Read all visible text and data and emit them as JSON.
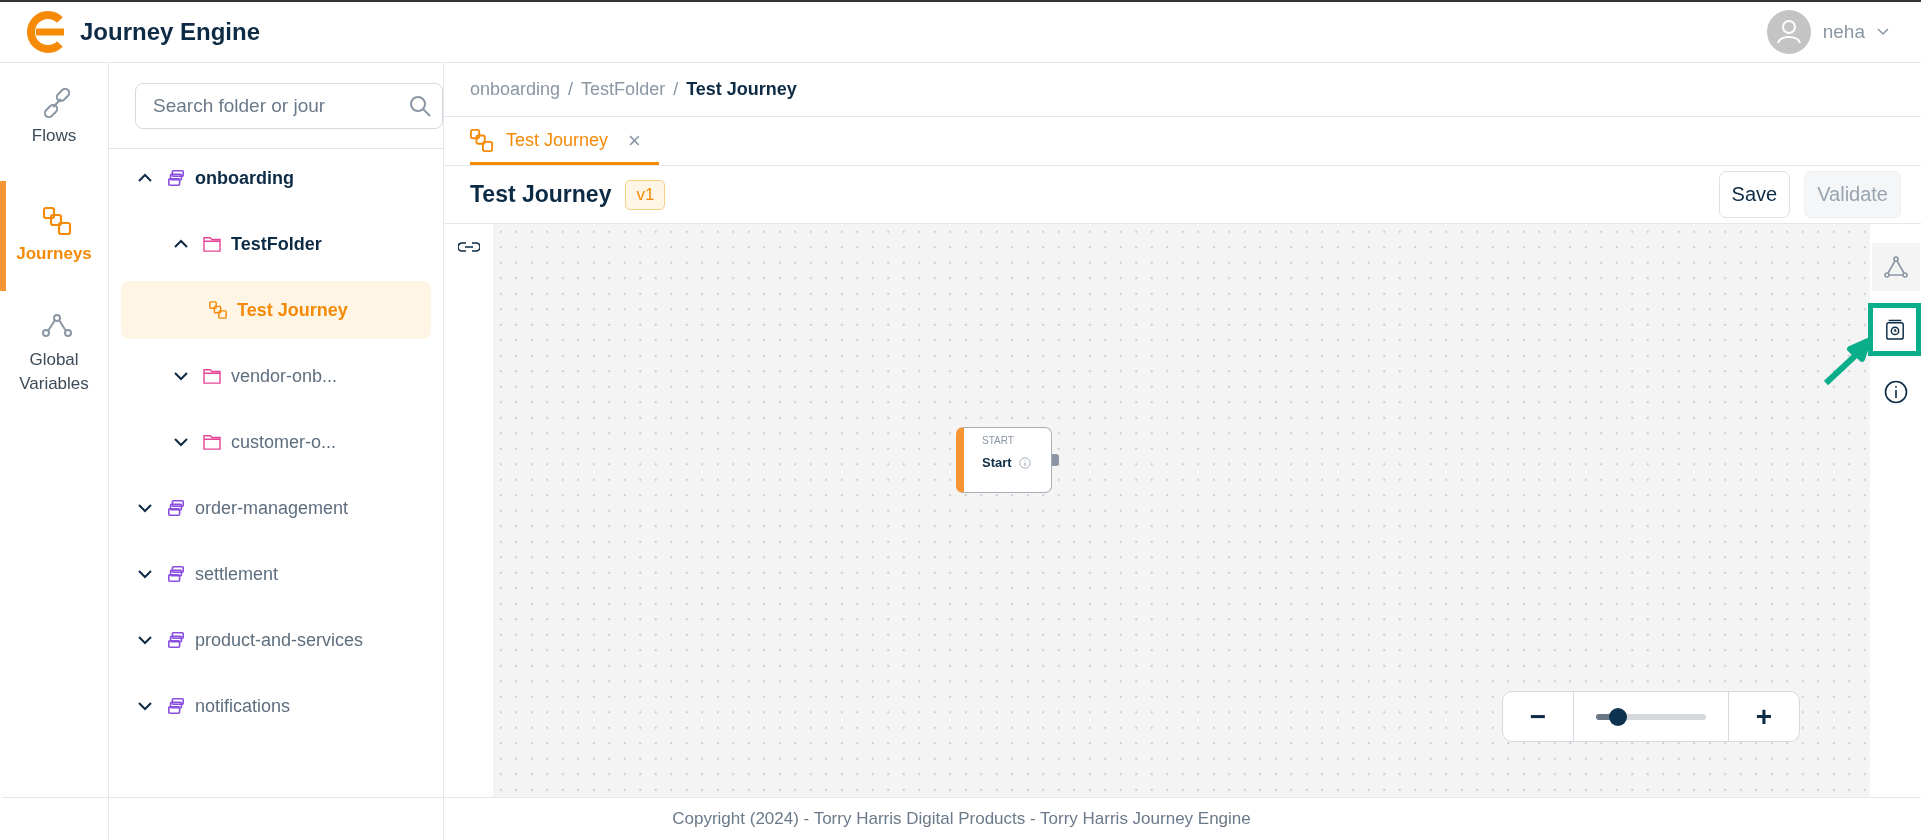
{
  "header": {
    "app_name": "Journey Engine",
    "user": {
      "name": "neha"
    }
  },
  "nav": [
    {
      "label": "Flows",
      "kind": "flows",
      "selected": false
    },
    {
      "label": "Journeys",
      "kind": "journeys",
      "selected": true
    },
    {
      "label": "Global Variables",
      "kind": "variables",
      "selected": false
    }
  ],
  "search": {
    "placeholder": "Search folder or jour"
  },
  "tree": [
    {
      "label": "onboarding",
      "kind": "project",
      "expanded": true,
      "selected": false,
      "children": [
        {
          "label": "TestFolder",
          "kind": "folder",
          "expanded": true,
          "selected": false,
          "children": [
            {
              "label": "Test Journey",
              "kind": "journey",
              "selected": true
            }
          ]
        },
        {
          "label": "vendor-onb...",
          "kind": "folder",
          "expanded": false,
          "selected": false
        },
        {
          "label": "customer-o...",
          "kind": "folder",
          "expanded": false,
          "selected": false
        }
      ]
    },
    {
      "label": "order-management",
      "kind": "project",
      "expanded": false,
      "selected": false
    },
    {
      "label": "settlement",
      "kind": "project",
      "expanded": false,
      "selected": false
    },
    {
      "label": "product-and-services",
      "kind": "project",
      "expanded": false,
      "selected": false
    },
    {
      "label": "notifications",
      "kind": "project",
      "expanded": false,
      "selected": false
    }
  ],
  "breadcrumb": {
    "separator": "/",
    "items": [
      "onboarding",
      "TestFolder",
      "Test Journey"
    ]
  },
  "tabs": [
    {
      "label": "Test Journey",
      "selected": true,
      "close": "×"
    }
  ],
  "journey": {
    "title": "Test Journey",
    "version": "v1"
  },
  "buttons": [
    {
      "label": "Save",
      "disabled": false
    },
    {
      "label": "Validate",
      "disabled": true
    }
  ],
  "node": {
    "type_label": "START",
    "name": "Start"
  },
  "zoom": {
    "minus": "−",
    "plus": "+",
    "level": 0.2
  },
  "rail": [
    {
      "kind": "graph",
      "highlighted": false
    },
    {
      "kind": "history",
      "highlighted": true
    },
    {
      "kind": "info",
      "highlighted": false
    }
  ],
  "footer": "Copyright (2024) - Torry Harris Digital Products - Torry Harris Journey Engine"
}
